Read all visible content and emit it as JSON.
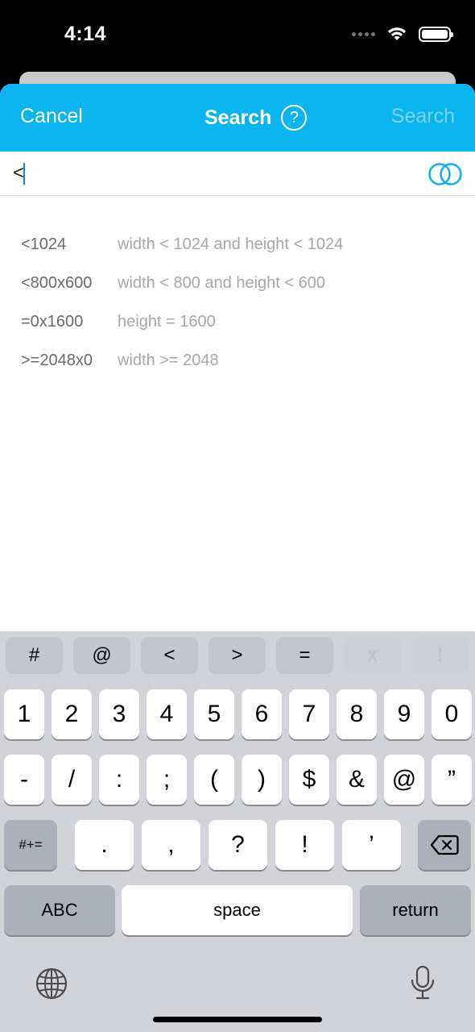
{
  "status": {
    "time": "4:14"
  },
  "nav": {
    "cancel": "Cancel",
    "title": "Search",
    "help_glyph": "?",
    "search": "Search"
  },
  "search": {
    "value": "<",
    "icon": "venn-rings-icon",
    "accent": "#0ab4ef"
  },
  "suggestions": [
    {
      "key": "<1024",
      "desc": "width < 1024 and height < 1024"
    },
    {
      "key": "<800x600",
      "desc": "width < 800 and height < 600"
    },
    {
      "key": "=0x1600",
      "desc": "height = 1600"
    },
    {
      "key": ">=2048x0",
      "desc": "width >= 2048"
    }
  ],
  "keyboard": {
    "top_row": [
      "#",
      "@",
      "<",
      ">",
      "=",
      "x",
      "!"
    ],
    "row1": [
      "1",
      "2",
      "3",
      "4",
      "5",
      "6",
      "7",
      "8",
      "9",
      "0"
    ],
    "row2": [
      "-",
      "/",
      ":",
      ";",
      "(",
      ")",
      "$",
      "&",
      "@",
      "”"
    ],
    "row3": [
      ".",
      ",",
      "?",
      "!",
      "’"
    ],
    "shift_label": "#+=",
    "abc_label": "ABC",
    "space_label": "space",
    "return_label": "return"
  }
}
